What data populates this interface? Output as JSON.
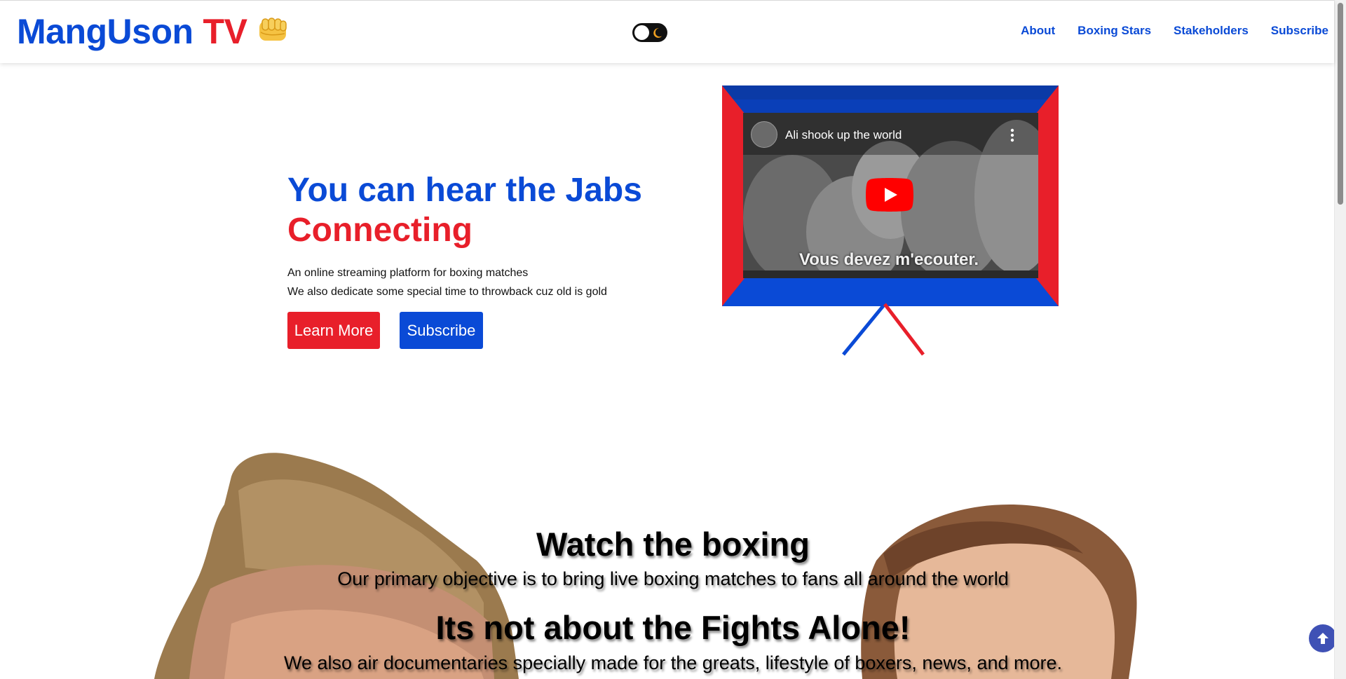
{
  "header": {
    "brand": "MangUson",
    "brand_accent": "TV",
    "nav": [
      "About",
      "Boxing Stars",
      "Stakeholders",
      "Subscribe"
    ]
  },
  "hero": {
    "title_line1": "You can hear the Jabs",
    "title_line2": "Connecting",
    "subtitle_line1": "An online streaming platform for boxing matches",
    "subtitle_line2": "We also dedicate some special time to throwback cuz old is gold",
    "learn_more_label": "Learn More",
    "subscribe_label": "Subscribe"
  },
  "video": {
    "title": "Ali shook up the world",
    "caption": "Vous devez m'ecouter."
  },
  "lower": {
    "heading1": "Watch the boxing",
    "text1": "Our primary objective is to bring live boxing matches to fans all around the world",
    "heading2": "Its not about the Fights Alone!",
    "text2": "We also air documentaries specially made for the greats, lifestyle of boxers, news, and more."
  },
  "colors": {
    "blue": "#0a4ad6",
    "red": "#e81f2a",
    "to_top": "#3f51b5"
  },
  "icons": [
    "fist-icon",
    "moon-icon",
    "play-icon",
    "more-vert-icon",
    "arrow-up-icon"
  ]
}
